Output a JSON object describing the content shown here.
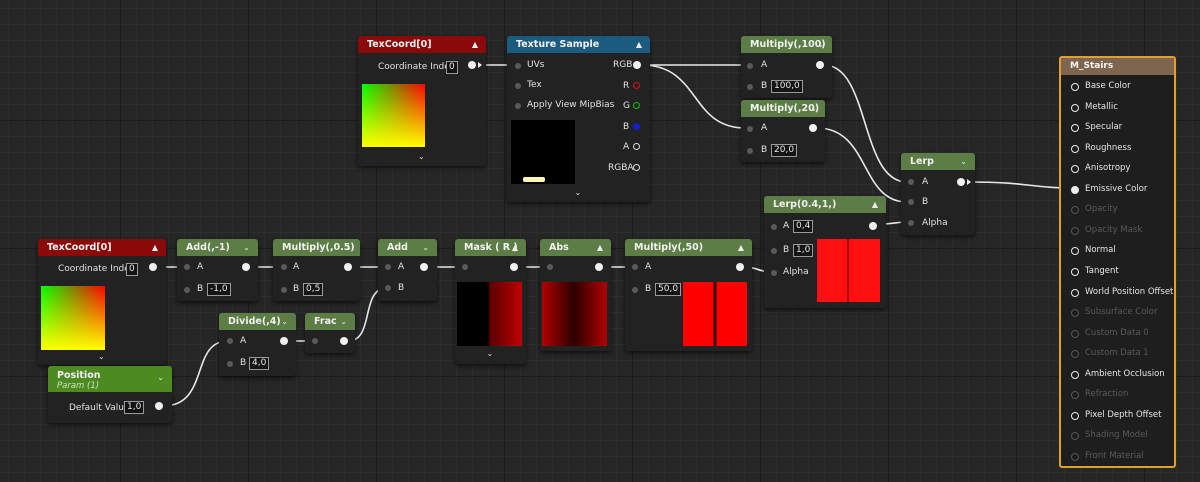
{
  "nodes": {
    "texcoord_top": {
      "title": "TexCoord[0]",
      "index_label": "Coordinate Index",
      "index_value": "0"
    },
    "texture_sample": {
      "title": "Texture Sample",
      "uvs": "UVs",
      "tex": "Tex",
      "mipbias": "Apply View MipBias",
      "rgb": "RGB",
      "r": "R",
      "g": "G",
      "b": "B",
      "a": "A",
      "rgba": "RGBA"
    },
    "multiply_100": {
      "title": "Multiply(,100)",
      "a": "A",
      "b": "B",
      "b_value": "100,0"
    },
    "multiply_20": {
      "title": "Multiply(,20)",
      "a": "A",
      "b": "B",
      "b_value": "20,0"
    },
    "lerp": {
      "title": "Lerp",
      "a": "A",
      "b": "B",
      "alpha": "Alpha"
    },
    "lerp_04": {
      "title": "Lerp(0.4,1,)",
      "a": "A",
      "a_value": "0,4",
      "b": "B",
      "b_value": "1,0",
      "alpha": "Alpha"
    },
    "texcoord_bottom": {
      "title": "TexCoord[0]",
      "index_label": "Coordinate Index",
      "index_value": "0"
    },
    "add_neg1": {
      "title": "Add(,-1)",
      "a": "A",
      "b": "B",
      "b_value": "-1,0"
    },
    "multiply_05": {
      "title": "Multiply(,0.5)",
      "a": "A",
      "b": "B",
      "b_value": "0,5"
    },
    "add": {
      "title": "Add",
      "a": "A",
      "b": "B"
    },
    "mask_r": {
      "title": "Mask ( R )"
    },
    "abs": {
      "title": "Abs"
    },
    "multiply_50": {
      "title": "Multiply(,50)",
      "a": "A",
      "b": "B",
      "b_value": "50,0"
    },
    "divide_4": {
      "title": "Divide(,4)",
      "a": "A",
      "b": "B",
      "b_value": "4,0"
    },
    "frac": {
      "title": "Frac"
    },
    "position": {
      "title": "Position",
      "subtitle": "Param (1)",
      "default_label": "Default Value",
      "default_value": "1,0"
    }
  },
  "result": {
    "title": "M_Stairs",
    "inputs": [
      {
        "label": "Base Color",
        "enabled": true,
        "connected": false
      },
      {
        "label": "Metallic",
        "enabled": true,
        "connected": false
      },
      {
        "label": "Specular",
        "enabled": true,
        "connected": false
      },
      {
        "label": "Roughness",
        "enabled": true,
        "connected": false
      },
      {
        "label": "Anisotropy",
        "enabled": true,
        "connected": false
      },
      {
        "label": "Emissive Color",
        "enabled": true,
        "connected": true
      },
      {
        "label": "Opacity",
        "enabled": false,
        "connected": false
      },
      {
        "label": "Opacity Mask",
        "enabled": false,
        "connected": false
      },
      {
        "label": "Normal",
        "enabled": true,
        "connected": false
      },
      {
        "label": "Tangent",
        "enabled": true,
        "connected": false
      },
      {
        "label": "World Position Offset",
        "enabled": true,
        "connected": false
      },
      {
        "label": "Subsurface Color",
        "enabled": false,
        "connected": false
      },
      {
        "label": "Custom Data 0",
        "enabled": false,
        "connected": false
      },
      {
        "label": "Custom Data 1",
        "enabled": false,
        "connected": false
      },
      {
        "label": "Ambient Occlusion",
        "enabled": true,
        "connected": false
      },
      {
        "label": "Refraction",
        "enabled": false,
        "connected": false
      },
      {
        "label": "Pixel Depth Offset",
        "enabled": true,
        "connected": false
      },
      {
        "label": "Shading Model",
        "enabled": false,
        "connected": false
      },
      {
        "label": "Front Material",
        "enabled": false,
        "connected": false
      }
    ]
  },
  "colors": {
    "header_red": "#8a0a0a",
    "header_green": "#5c7d45",
    "header_blue": "#1c5b80",
    "header_param": "#4d8a22",
    "result_border": "#e2a02a",
    "result_header": "#7d6550",
    "pin_r": "#e01010",
    "pin_g": "#10c010",
    "pin_b": "#1020d0"
  },
  "icons": [
    "chevron-up-icon",
    "chevron-down-icon",
    "exec-pin-icon",
    "output-pin-icon"
  ]
}
